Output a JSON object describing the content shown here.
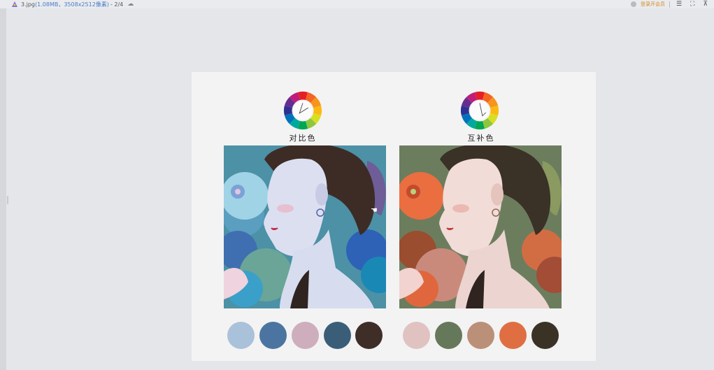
{
  "titlebar": {
    "filename": "3.jpg",
    "meta": "(1.08MB，3508x2512像素)",
    "page": "- 2/4",
    "vip_label": "登录开会员",
    "controls": [
      "☰",
      "⛶",
      "⊼"
    ]
  },
  "panels": [
    {
      "caption": "对比色",
      "palette": [
        "#a9c2da",
        "#4b75a0",
        "#ceaebc",
        "#3b5e78",
        "#3f2d28"
      ],
      "scheme": "cool"
    },
    {
      "caption": "互补色",
      "palette": [
        "#e0c3c1",
        "#66785a",
        "#bb9078",
        "#df6f43",
        "#3a3325"
      ],
      "scheme": "warm"
    }
  ],
  "icons": {
    "app": "image-viewer-icon",
    "cloud": "cloud-icon",
    "user": "user-avatar-icon"
  }
}
